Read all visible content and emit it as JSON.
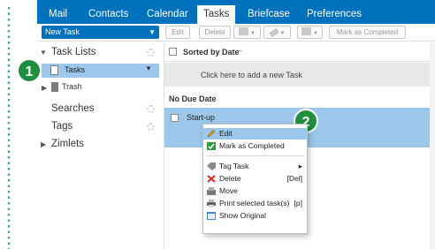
{
  "tabs": [
    {
      "label": "Mail"
    },
    {
      "label": "Contacts"
    },
    {
      "label": "Calendar"
    },
    {
      "label": "Tasks",
      "active": true
    },
    {
      "label": "Briefcase"
    },
    {
      "label": "Preferences"
    }
  ],
  "toolbar": {
    "new_task": "New Task",
    "edit": "Edit",
    "delete": "Delete",
    "mark_completed": "Mark as Completed"
  },
  "sidebar": {
    "task_lists": "Task Lists",
    "tasks": "Tasks",
    "trash": "Trash",
    "searches": "Searches",
    "tags": "Tags",
    "zimlets": "Zimlets"
  },
  "main": {
    "sort_header": "Sorted by Date",
    "add_new": "Click here to add a new Task",
    "group": "No Due Date",
    "task": "Start-up"
  },
  "context_menu": {
    "items": [
      {
        "label": "Edit",
        "icon": "pencil-icon"
      },
      {
        "label": "Mark as Completed",
        "icon": "checkmark-icon"
      },
      {
        "label": "Tag Task",
        "icon": "tag-icon"
      },
      {
        "label": "Delete",
        "shortcut": "[Del]",
        "icon": "delete-x-icon"
      },
      {
        "label": "Move",
        "icon": "move-icon"
      },
      {
        "label": "Print selected task(s)",
        "shortcut": "[p]",
        "icon": "print-icon"
      },
      {
        "label": "Show Original",
        "icon": "show-original-icon"
      }
    ]
  },
  "badges": {
    "one": "1",
    "two": "2"
  },
  "colors": {
    "accent": "#0071bc",
    "selection": "#9cc7ea",
    "badge": "#1f8f3e"
  }
}
